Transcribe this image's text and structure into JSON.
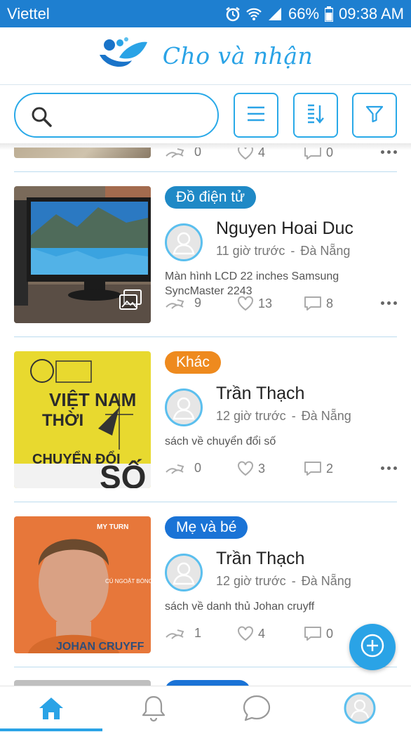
{
  "status_bar": {
    "carrier": "Viettel",
    "battery": "66%",
    "time": "09:38 AM",
    "icons": [
      "alarm-icon",
      "wifi-icon",
      "signal-icon",
      "battery-icon"
    ]
  },
  "header": {
    "app_name": "Cho và nhận",
    "logo": "leaf-people-logo"
  },
  "search": {
    "placeholder": "",
    "value": ""
  },
  "toolbar": {
    "buttons": [
      "menu-icon",
      "sort-icon",
      "filter-icon"
    ]
  },
  "colors": {
    "accent": "#2aa3e6",
    "status_bar": "#1e7fd0",
    "tag_electronics": "#1f89c6",
    "tag_other": "#ee8a1e",
    "tag_mom_baby": "#1a73d6"
  },
  "partial_item": {
    "shares": "0",
    "likes": "4",
    "comments": "0"
  },
  "items": [
    {
      "category": "Đồ điện tử",
      "user": "Nguyen Hoai Duc",
      "time": "11 giờ trước",
      "location": "Đà Nẵng",
      "description": "Màn hình LCD 22 inches Samsung SyncMaster  2243",
      "shares": "9",
      "likes": "13",
      "comments": "8",
      "has_gallery": true
    },
    {
      "category": "Khác",
      "user": "Trần Thạch",
      "time": "12 giờ trước",
      "location": "Đà Nẵng",
      "description": "sách về chuyển đổi số",
      "shares": "0",
      "likes": "3",
      "comments": "2",
      "image_text": [
        "VIỆT NAM",
        "THỜI",
        "CHUYỂN ĐỔI",
        "SỐ"
      ]
    },
    {
      "category": "Mẹ và bé",
      "user": "Trần Thạch",
      "time": "12 giờ trước",
      "location": "Đà Nẵng",
      "description": "sách về danh thủ Johan cruyff",
      "shares": "1",
      "likes": "4",
      "comments": "0",
      "image_text": [
        "MY TURN",
        "CÚ NGOẶT BÓNG CỦA TÔI",
        "JOHAN CRUYFF"
      ]
    }
  ],
  "bottom_nav": {
    "items": [
      "home-icon",
      "bell-icon",
      "chat-icon",
      "profile-icon"
    ],
    "active": "home-icon"
  }
}
